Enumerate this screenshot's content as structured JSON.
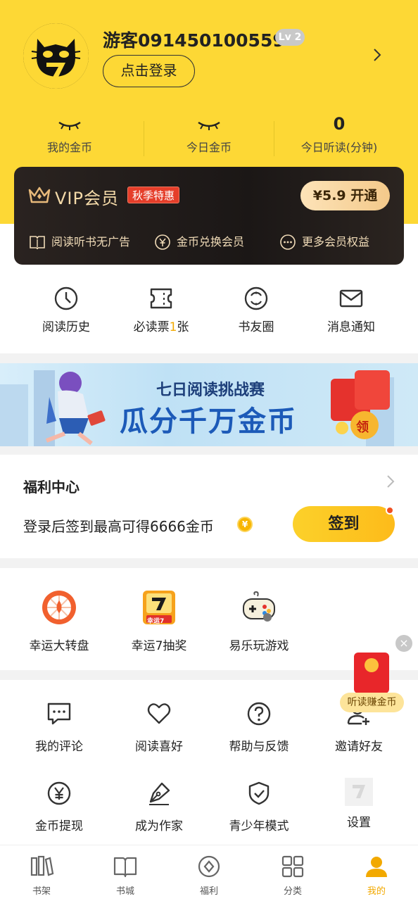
{
  "profile": {
    "username": "游客091450100559",
    "level": "Lv 2",
    "login_button": "点击登录"
  },
  "stats": [
    {
      "value": "",
      "label": "我的金币",
      "hidden_icon": "eye-closed-icon"
    },
    {
      "value": "",
      "label": "今日金币",
      "hidden_icon": "eye-closed-icon"
    },
    {
      "value": "0",
      "label": "今日听读(分钟)"
    }
  ],
  "vip": {
    "title": "VIP会员",
    "tag": "秋季特惠",
    "button": "¥5.9 开通",
    "features": [
      "阅读听书无广告",
      "金币兑换会员",
      "更多会员权益"
    ]
  },
  "quick_actions": [
    {
      "label": "阅读历史",
      "icon": "clock-icon"
    },
    {
      "label_prefix": "必读票",
      "label_count": "1",
      "label_suffix": "张",
      "icon": "ticket-icon"
    },
    {
      "label": "书友圈",
      "icon": "circle-icon"
    },
    {
      "label": "消息通知",
      "icon": "mail-icon"
    }
  ],
  "banner": {
    "subtitle": "七日阅读挑战赛",
    "title": "瓜分千万金币",
    "badge": "领"
  },
  "welfare": {
    "title": "福利中心",
    "description": "登录后签到最高可得6666金币",
    "sign_button": "签到"
  },
  "games": [
    {
      "label": "幸运大转盘",
      "icon": "wheel-icon"
    },
    {
      "label": "幸运7抽奖",
      "icon": "lucky7-icon",
      "icon_text": "幸运7"
    },
    {
      "label": "易乐玩游戏",
      "icon": "gamepad-icon"
    }
  ],
  "float_widget": {
    "label": "听读赚金币"
  },
  "tools": [
    {
      "label": "我的评论",
      "icon": "comment-icon"
    },
    {
      "label": "阅读喜好",
      "icon": "heart-icon"
    },
    {
      "label": "帮助与反馈",
      "icon": "help-icon"
    },
    {
      "label": "邀请好友",
      "icon": "add-user-icon"
    },
    {
      "label": "金币提现",
      "icon": "yen-icon"
    },
    {
      "label": "成为作家",
      "icon": "pen-icon"
    },
    {
      "label": "青少年模式",
      "icon": "shield-icon"
    },
    {
      "label": "设置",
      "icon": "settings-icon"
    }
  ],
  "nav": [
    {
      "label": "书架",
      "icon": "bookshelf-icon"
    },
    {
      "label": "书城",
      "icon": "book-icon"
    },
    {
      "label": "福利",
      "icon": "diamond-icon"
    },
    {
      "label": "分类",
      "icon": "grid-icon"
    },
    {
      "label": "我的",
      "icon": "user-icon",
      "active": true
    }
  ],
  "colors": {
    "brand_yellow": "#fdd835",
    "vip_gold": "#f3d9a8",
    "active": "#f2a900"
  }
}
